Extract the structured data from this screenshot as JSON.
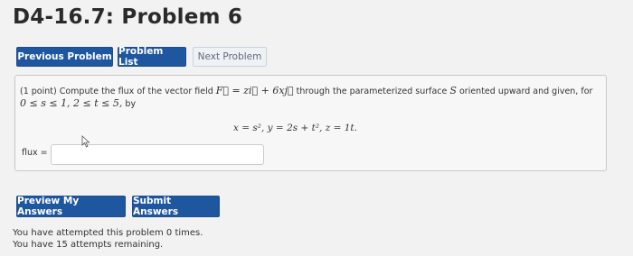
{
  "page": {
    "title": "D4-16.7: Problem 6"
  },
  "nav": {
    "previous_label": "Previous Problem",
    "list_label": "Problem List",
    "next_label": "Next Problem"
  },
  "problem": {
    "intro": "(1 point) Compute the flux of the vector field",
    "field": "F⃗ = zi⃗ + 6xj⃗",
    "through": "through the parameterized surface",
    "surface": "S",
    "oriented": "oriented upward and given, for",
    "range": "0 ≤ s ≤ 1,  2 ≤ t ≤ 5,",
    "by": "by",
    "equation": "x = s²,   y = 2s + t²,   z = 1t."
  },
  "answer": {
    "label": "flux =",
    "value": ""
  },
  "actions": {
    "preview_label": "Preview My Answers",
    "submit_label": "Submit Answers"
  },
  "status": {
    "attempted": "You have attempted this problem 0 times.",
    "remaining": "You have 15 attempts remaining."
  }
}
